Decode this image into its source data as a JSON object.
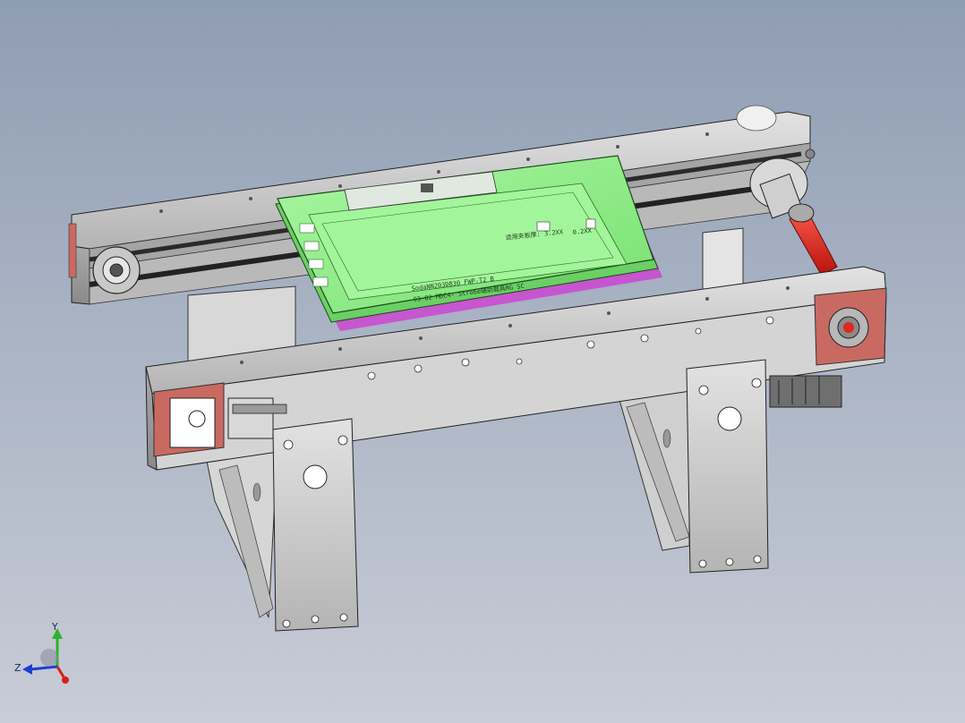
{
  "model": {
    "pcb_line_1": "SodaNN203DB30 FWP-T2 B",
    "pcb_line_2": "93-02 MDC4- Strobe辅助载具RG SC",
    "pcb_label_a": "适用夹板厚: 3.2XX",
    "pcb_label_b": "0.2XX"
  },
  "triad": {
    "y_label": "Y",
    "z_label": "Z"
  },
  "colors": {
    "background_top": "#8f9db3",
    "background_bottom": "#c8ccd6",
    "steel": "#c9c9c9",
    "fixture_green": "#8ef08a",
    "bracket_red": "#c96a62",
    "shaft_red": "#e0261e",
    "magenta_edge": "#d42fd4"
  },
  "icons": [
    "coordinate-triad-icon"
  ]
}
